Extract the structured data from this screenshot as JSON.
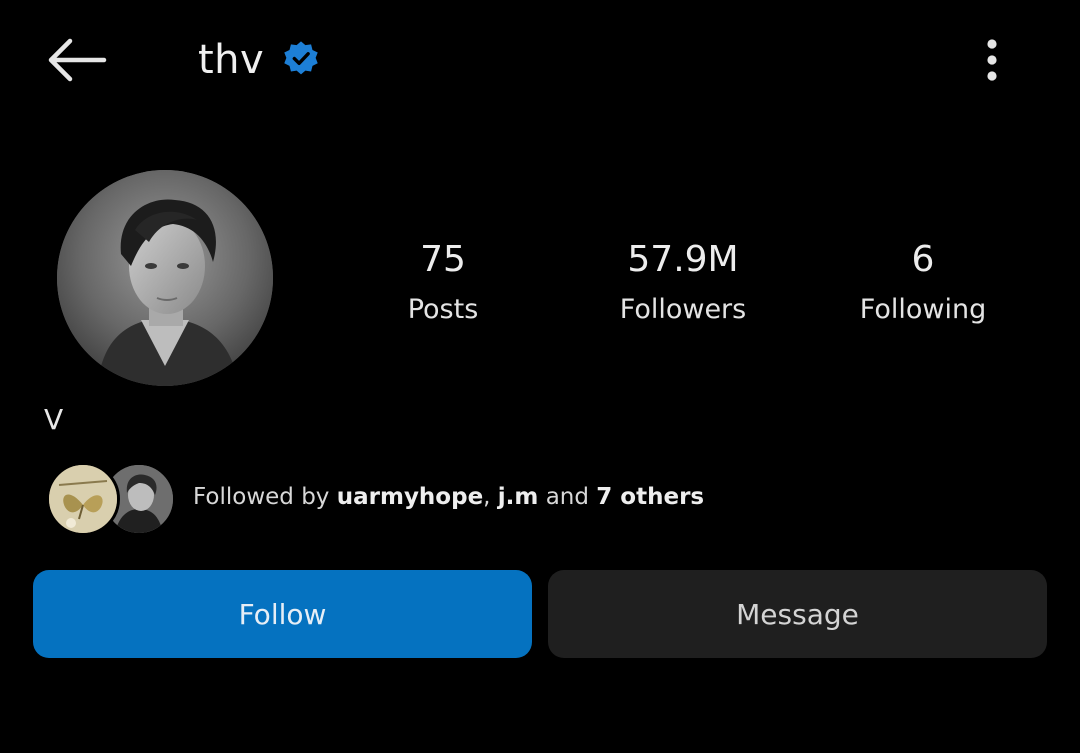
{
  "header": {
    "username": "thv",
    "back_icon": "arrow-left-icon",
    "verified_icon": "verified-badge-icon",
    "more_icon": "more-vertical-icon"
  },
  "profile": {
    "avatar": "profile-photo",
    "display_name": "V"
  },
  "stats": [
    {
      "value": "75",
      "label": "Posts"
    },
    {
      "value": "57.9M",
      "label": "Followers"
    },
    {
      "value": "6",
      "label": "Following"
    }
  ],
  "followed_by": {
    "prefix": "Followed by",
    "users": [
      "uarmyhope",
      "j.m"
    ],
    "separator": ",",
    "conjunction": "and",
    "others": "7 others"
  },
  "actions": {
    "follow_label": "Follow",
    "message_label": "Message"
  },
  "colors": {
    "background": "#000000",
    "follow_button": "#0572c0",
    "message_button": "#1f1f1f",
    "verified_badge": "#1d7fd6"
  }
}
